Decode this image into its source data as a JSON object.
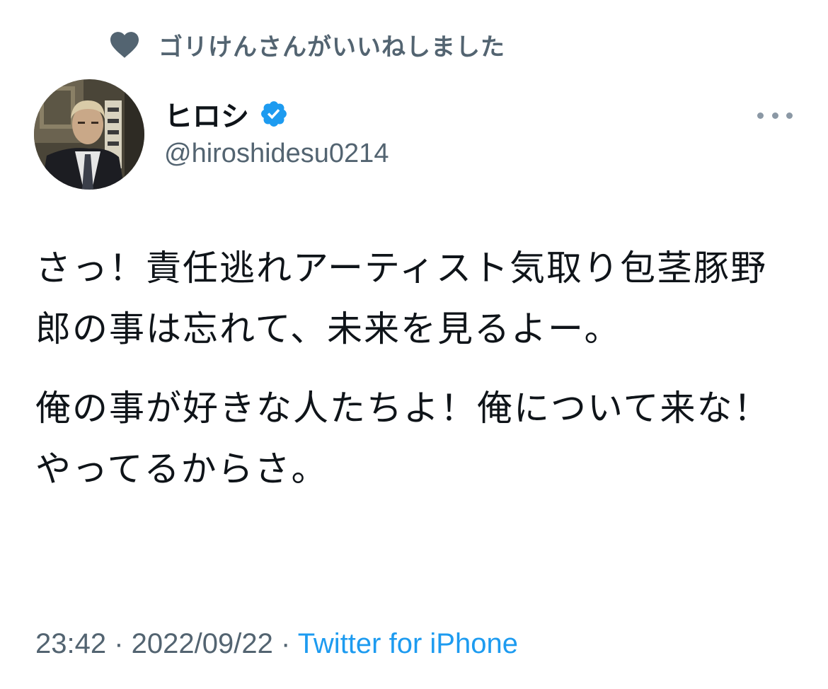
{
  "social_context": {
    "icon": "heart-icon",
    "text": "ゴリけんさんがいいねしました"
  },
  "author": {
    "display_name": "ヒロシ",
    "handle": "@hiroshidesu0214",
    "verified_icon": "verified-badge-icon",
    "avatar": "avatar-photo"
  },
  "menu": {
    "icon": "more-options-icon"
  },
  "tweet": {
    "paragraph_1": "さっ！責任逃れアーティスト気取り包茎豚野郎の事は忘れて、未来を見るよー。",
    "paragraph_2": "俺の事が好きな人たちよ！俺について来な！やってるからさ。"
  },
  "meta": {
    "time": "23:42",
    "separator": " · ",
    "date": "2022/09/22",
    "source": "Twitter for iPhone"
  },
  "colors": {
    "text_primary": "#0f1419",
    "text_secondary": "#536471",
    "link": "#1d9bf0",
    "verified": "#1d9bf0"
  }
}
